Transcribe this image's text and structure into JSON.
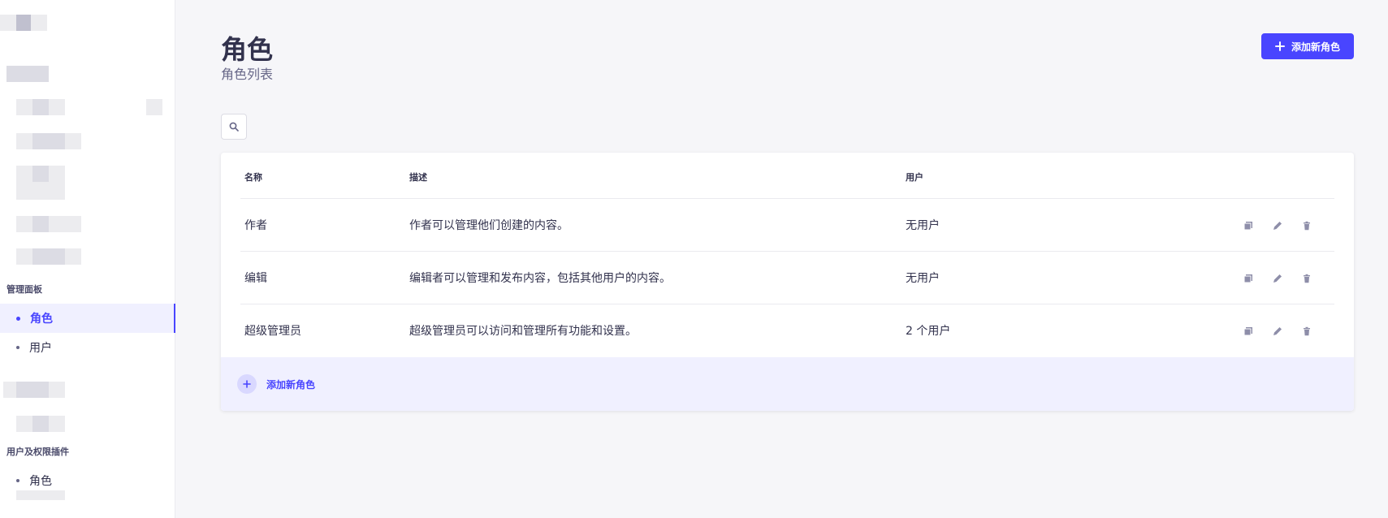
{
  "sidebar": {
    "section_admin": "管理面板",
    "admin_items": [
      {
        "label": "角色",
        "active": true
      },
      {
        "label": "用户",
        "active": false
      }
    ],
    "section_plugin": "用户及权限插件",
    "plugin_items": [
      {
        "label": "角色",
        "active": false
      }
    ]
  },
  "header": {
    "title": "角色",
    "subtitle": "角色列表",
    "add_button_label": "添加新角色"
  },
  "table": {
    "columns": [
      "名称",
      "描述",
      "用户"
    ],
    "rows": [
      {
        "name": "作者",
        "description": "作者可以管理他们创建的内容。",
        "users": "无用户"
      },
      {
        "name": "编辑",
        "description": "编辑者可以管理和发布内容，包括其他用户的内容。",
        "users": "无用户"
      },
      {
        "name": "超级管理员",
        "description": "超级管理员可以访问和管理所有功能和设置。",
        "users": "2 个用户"
      }
    ],
    "add_row_label": "添加新角色"
  },
  "icons": {
    "search": "search-icon",
    "add": "plus-icon",
    "duplicate": "duplicate-icon",
    "edit": "pencil-icon",
    "delete": "trash-icon"
  },
  "colors": {
    "primary": "#4945ff",
    "background": "#f6f6f9",
    "active_nav_bg": "#f0f0ff"
  }
}
